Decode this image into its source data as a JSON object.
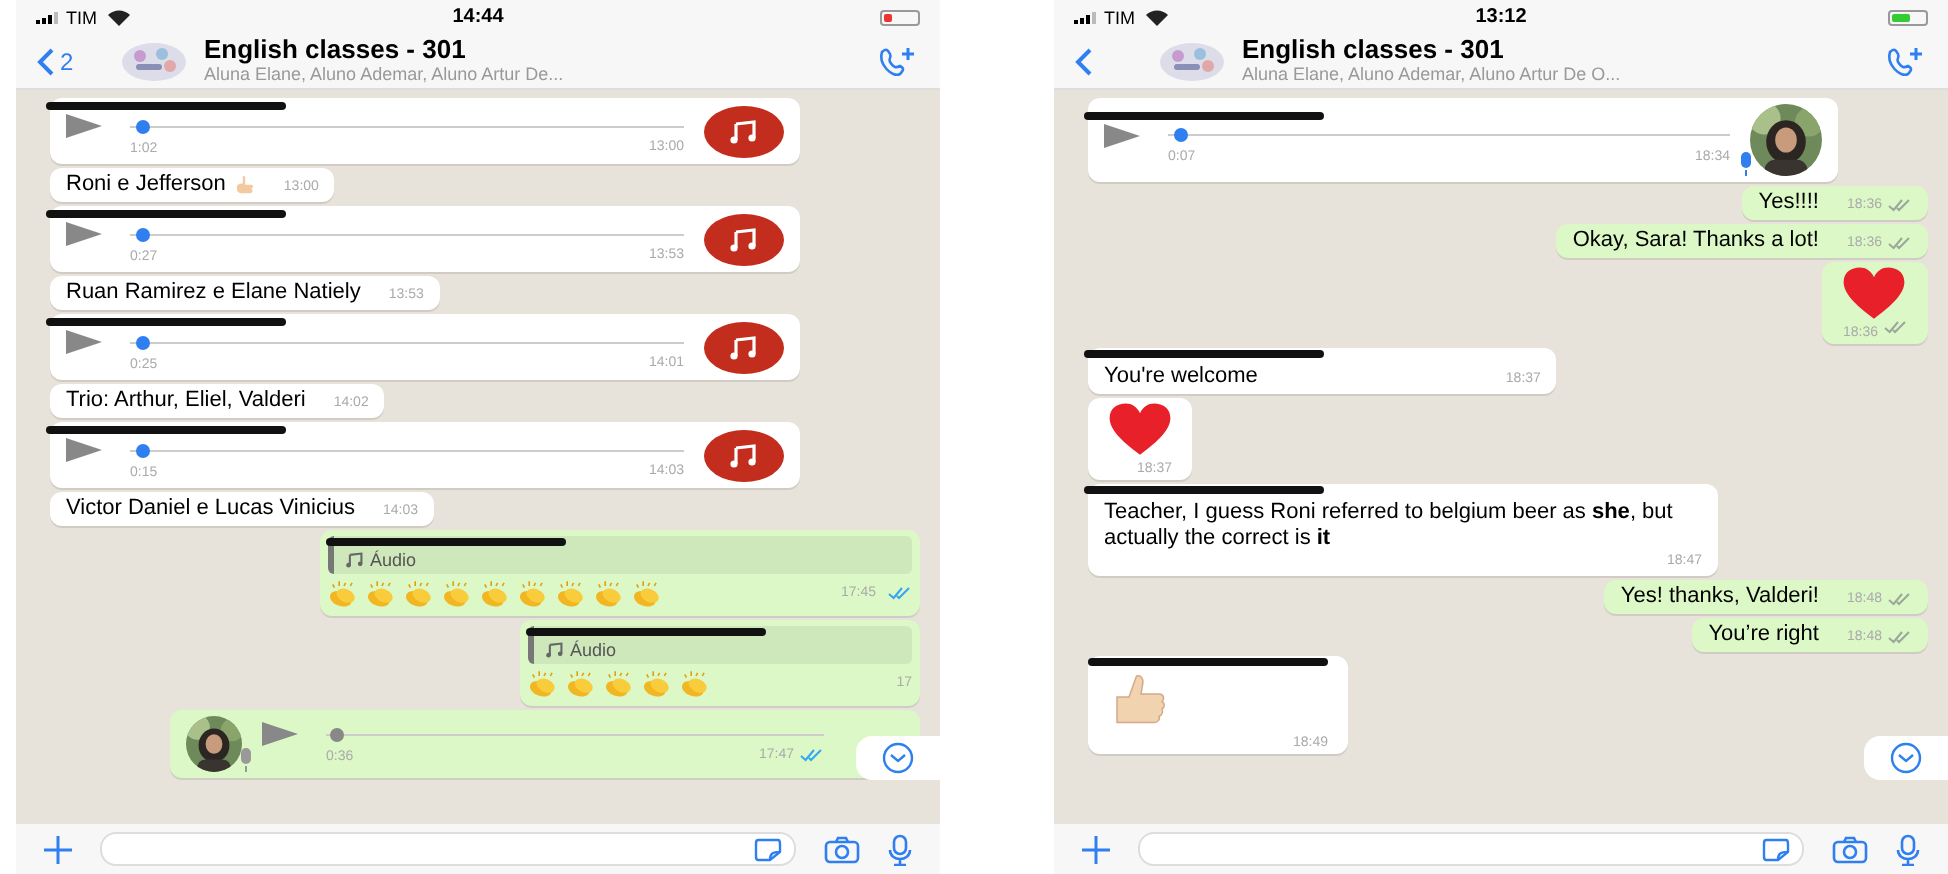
{
  "phones": [
    {
      "status": {
        "carrier": "TIM",
        "time": "14:44",
        "battery_low": true
      },
      "header": {
        "back_count": "2",
        "title": "English classes - 301",
        "subtitle": "Aluna Elane, Aluno Ademar, Aluno Artur De..."
      },
      "messages": [
        {
          "kind": "audio",
          "outgoing": false,
          "redacted": true,
          "duration": "1:02",
          "time": "13:00",
          "level": 0.02,
          "avatar": {
            "kind": "music"
          }
        },
        {
          "kind": "text",
          "outgoing": false,
          "redacted": false,
          "text": "Roni e Jefferson",
          "stickers": [
            {
              "kind": "point"
            }
          ],
          "time": "13:00"
        },
        {
          "kind": "audio",
          "outgoing": false,
          "redacted": true,
          "duration": "0:27",
          "time": "13:53",
          "level": 0.02,
          "avatar": {
            "kind": "music"
          }
        },
        {
          "kind": "text",
          "outgoing": false,
          "redacted": false,
          "text": "Ruan Ramirez e Elane Natiely",
          "time": "13:53"
        },
        {
          "kind": "audio",
          "outgoing": false,
          "redacted": true,
          "duration": "0:25",
          "time": "14:01",
          "level": 0.02,
          "avatar": {
            "kind": "music"
          }
        },
        {
          "kind": "text",
          "outgoing": false,
          "redacted": false,
          "text": "Trio: Arthur, Eliel, Valderi",
          "time": "14:02"
        },
        {
          "kind": "audio",
          "outgoing": false,
          "redacted": true,
          "duration": "0:15",
          "time": "14:03",
          "level": 0.02,
          "avatar": {
            "kind": "music"
          }
        },
        {
          "kind": "text",
          "outgoing": false,
          "redacted": false,
          "text": "Victor Daniel e Lucas Vinicius",
          "time": "14:03"
        },
        {
          "kind": "quote",
          "outgoing": true,
          "redacted": true,
          "quote": "Áudio",
          "stickers": [
            {
              "kind": "clap"
            },
            {
              "kind": "clap"
            },
            {
              "kind": "clap"
            },
            {
              "kind": "clap"
            },
            {
              "kind": "clap"
            },
            {
              "kind": "clap"
            },
            {
              "kind": "clap"
            },
            {
              "kind": "clap"
            },
            {
              "kind": "clap"
            }
          ],
          "time": "17:45",
          "read": true
        },
        {
          "kind": "quote",
          "outgoing": true,
          "redacted": true,
          "quote": "Áudio",
          "stickers": [
            {
              "kind": "clap"
            },
            {
              "kind": "clap"
            },
            {
              "kind": "clap"
            },
            {
              "kind": "clap"
            },
            {
              "kind": "clap"
            }
          ],
          "time": "17"
        },
        {
          "kind": "audio",
          "outgoing": true,
          "redacted": false,
          "duration": "0:36",
          "time": "17:47",
          "level": 0.02,
          "read": true
        }
      ]
    },
    {
      "status": {
        "carrier": "TIM",
        "time": "13:12",
        "battery_low": false
      },
      "header": {
        "title": "English classes - 301",
        "subtitle": "Aluna Elane, Aluno Ademar, Aluno Artur De O..."
      },
      "messages": [
        {
          "kind": "audio",
          "outgoing": false,
          "redacted": true,
          "duration": "0:07",
          "time": "18:34",
          "level": 0.02
        },
        {
          "kind": "text",
          "outgoing": true,
          "redacted": false,
          "text": "Yes!!!!",
          "time": "18:36",
          "read": false
        },
        {
          "kind": "text",
          "outgoing": true,
          "redacted": false,
          "text": "Okay, Sara! Thanks a lot!",
          "time": "18:36",
          "read": false
        },
        {
          "kind": "emoji",
          "outgoing": true,
          "redacted": false,
          "stickers": [
            {
              "kind": "heart"
            }
          ],
          "time": "18:36",
          "read": false
        },
        {
          "kind": "text",
          "outgoing": false,
          "redacted": true,
          "text": "You're welcome",
          "time": "18:37"
        },
        {
          "kind": "emoji",
          "outgoing": false,
          "redacted": false,
          "stickers": [
            {
              "kind": "heart"
            }
          ],
          "time": "18:37"
        },
        {
          "kind": "text",
          "outgoing": false,
          "redacted": true,
          "text": "Teacher, I guess Roni referred to belgium beer as **she**, but actually the correct is **it**",
          "time": "18:47"
        },
        {
          "kind": "text",
          "outgoing": true,
          "redacted": false,
          "text": "Yes! thanks, Valderi!",
          "time": "18:48",
          "read": false
        },
        {
          "kind": "text",
          "outgoing": true,
          "redacted": false,
          "text": "You’re right",
          "time": "18:48",
          "read": false
        },
        {
          "kind": "emoji",
          "outgoing": false,
          "redacted": true,
          "stickers": [
            {
              "kind": "thumb"
            }
          ],
          "time": "18:49"
        }
      ]
    }
  ]
}
